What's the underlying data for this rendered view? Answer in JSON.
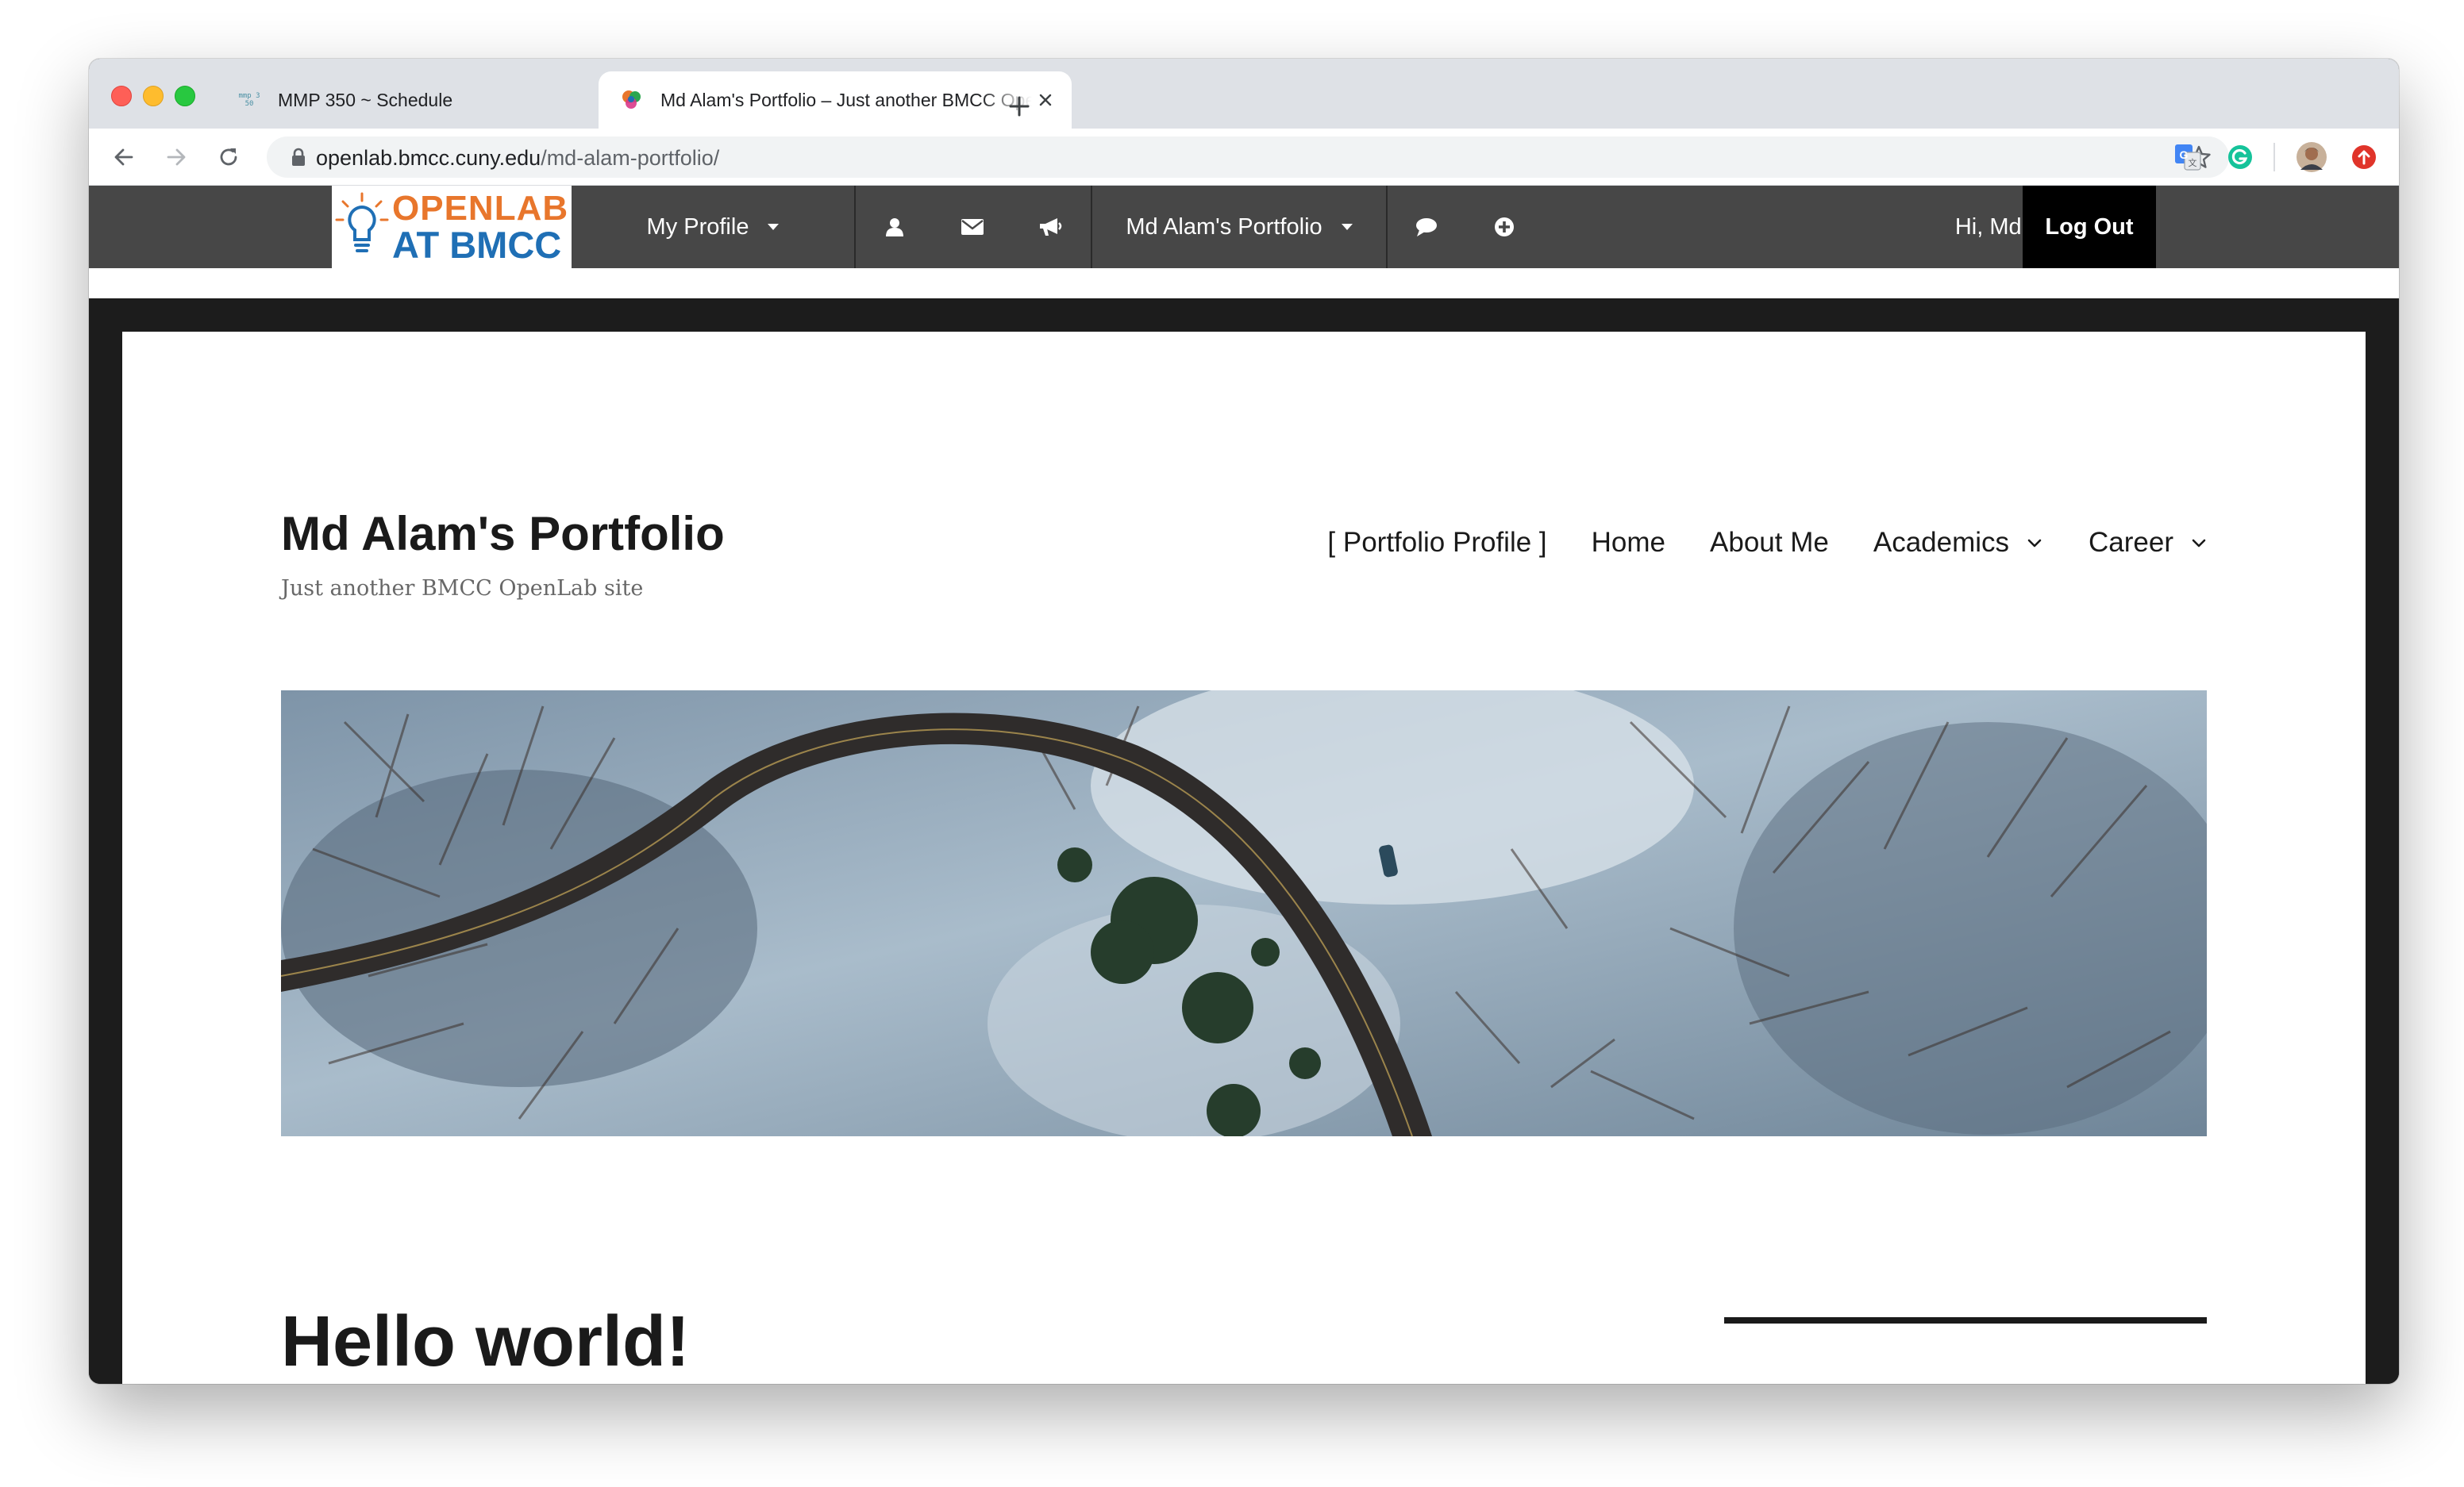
{
  "browser": {
    "tabs": [
      {
        "title": "MMP 350 ~ Schedule",
        "favicon": "mmp-350-favicon",
        "favicon_text": "mmp 350",
        "active": false
      },
      {
        "title": "Md Alam's Portfolio – Just another BMCC OpenLab site",
        "favicon": "openlab-favicon",
        "active": true
      }
    ],
    "url_host": "openlab.bmcc.cuny.edu",
    "url_path": "/md-alam-portfolio/",
    "toolbar_icons": [
      "back-arrow-icon",
      "forward-arrow-icon",
      "reload-icon",
      "lock-icon",
      "bookmark-star-icon"
    ],
    "extensions": [
      "google-translate-icon",
      "grammarly-icon",
      "profile-avatar",
      "update-badge-icon"
    ]
  },
  "adminbar": {
    "logo_line1": "OPENLAB",
    "logo_line2": "AT BMCC",
    "my_profile": "My Profile",
    "icons": [
      "user-icon",
      "envelope-icon",
      "megaphone-icon",
      "comment-icon",
      "plus-circle-icon"
    ],
    "site_menu": "Md Alam's Portfolio",
    "greeting": "Hi, Md Alam",
    "logout": "Log Out"
  },
  "site": {
    "title": "Md Alam's Portfolio",
    "description": "Just another BMCC OpenLab site",
    "nav": [
      {
        "label": "[ Portfolio Profile ]",
        "has_submenu": false
      },
      {
        "label": "Home",
        "has_submenu": false
      },
      {
        "label": "About Me",
        "has_submenu": false
      },
      {
        "label": "Academics",
        "has_submenu": true
      },
      {
        "label": "Career",
        "has_submenu": true
      }
    ],
    "header_image": "aerial-winter-road-forest"
  },
  "post": {
    "title": "Hello world!"
  },
  "colors": {
    "adminbar_bg": "#474747",
    "page_frame": "#1c1c1c",
    "logo_orange": "#e8762c",
    "logo_blue": "#1f6fb5",
    "text": "#1a1a1a"
  }
}
